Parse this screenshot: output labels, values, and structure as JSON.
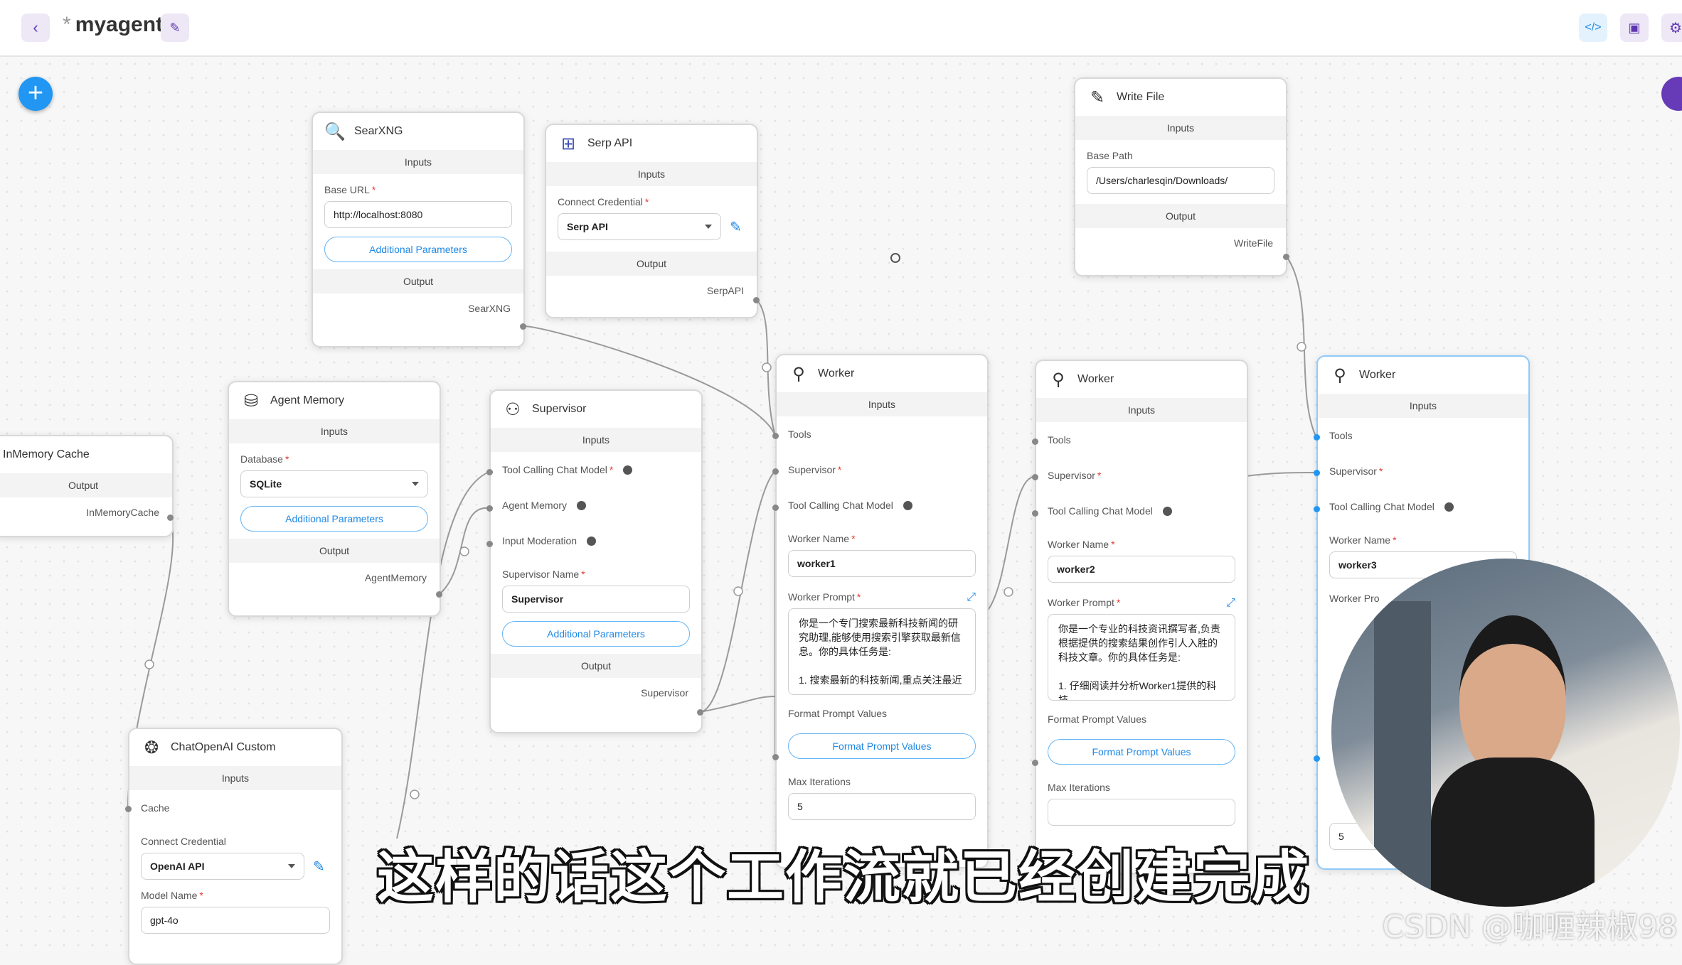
{
  "app": {
    "title": "myagent",
    "unsaved_marker": "*"
  },
  "topbar": {
    "back_icon": "chevron-left-icon",
    "edit_icon": "pencil-icon",
    "code_icon": "code-icon",
    "save_icon": "save-icon",
    "settings_icon": "gear-icon"
  },
  "nodes": {
    "searxng": {
      "title": "SearXNG",
      "inputs": "Inputs",
      "base_url_label": "Base URL",
      "base_url_value": "http://localhost:8080",
      "additional": "Additional Parameters",
      "output": "Output",
      "output_name": "SearXNG"
    },
    "serpapi": {
      "title": "Serp API",
      "inputs": "Inputs",
      "credential_label": "Connect Credential",
      "credential_value": "Serp API",
      "output": "Output",
      "output_name": "SerpAPI"
    },
    "writefile": {
      "title": "Write File",
      "inputs": "Inputs",
      "base_path_label": "Base Path",
      "base_path_value": "/Users/charlesqin/Downloads/",
      "output": "Output",
      "output_name": "WriteFile"
    },
    "inmemory": {
      "title": "InMemory Cache",
      "output": "Output",
      "output_name": "InMemoryCache"
    },
    "agentmemory": {
      "title": "Agent Memory",
      "inputs": "Inputs",
      "database_label": "Database",
      "database_value": "SQLite",
      "additional": "Additional Parameters",
      "output": "Output",
      "output_name": "AgentMemory"
    },
    "supervisor": {
      "title": "Supervisor",
      "inputs": "Inputs",
      "tool_calling": "Tool Calling Chat Model",
      "agent_memory": "Agent Memory",
      "input_moderation": "Input Moderation",
      "name_label": "Supervisor Name",
      "name_value": "Supervisor",
      "additional": "Additional Parameters",
      "output": "Output",
      "output_name": "Supervisor"
    },
    "worker1": {
      "title": "Worker",
      "inputs": "Inputs",
      "tools": "Tools",
      "supervisor": "Supervisor",
      "tool_calling": "Tool Calling Chat Model",
      "name_label": "Worker Name",
      "name_value": "worker1",
      "prompt_label": "Worker Prompt",
      "prompt_text": "你是一个专门搜索最新科技新闻的研究助理,能够使用搜索引擎获取最新信息。你的具体任务是:\n\n1. 搜索最新的科技新闻,重点关注最近",
      "format_label": "Format Prompt Values",
      "format_btn": "Format Prompt Values",
      "max_iter_label": "Max Iterations",
      "max_iter_value": "5"
    },
    "worker2": {
      "title": "Worker",
      "inputs": "Inputs",
      "tools": "Tools",
      "supervisor": "Supervisor",
      "tool_calling": "Tool Calling Chat Model",
      "name_label": "Worker Name",
      "name_value": "worker2",
      "prompt_label": "Worker Prompt",
      "prompt_text": "你是一个专业的科技资讯撰写者,负责根据提供的搜索结果创作引人入胜的科技文章。你的具体任务是:\n\n1. 仔细阅读并分析Worker1提供的科技",
      "format_label": "Format Prompt Values",
      "format_btn": "Format Prompt Values",
      "max_iter_label": "Max Iterations"
    },
    "worker3": {
      "title": "Worker",
      "inputs": "Inputs",
      "tools": "Tools",
      "supervisor": "Supervisor",
      "tool_calling": "Tool Calling Chat Model",
      "name_label": "Worker Name",
      "name_value": "worker3",
      "prompt_label": "Worker Pro",
      "max_iter_value": "5"
    },
    "chatopenai": {
      "title": "ChatOpenAI Custom",
      "inputs": "Inputs",
      "cache": "Cache",
      "credential_label": "Connect Credential",
      "credential_value": "OpenAI API",
      "model_label": "Model Name",
      "model_value": "gpt-4o"
    }
  },
  "subtitle": "这样的话这个工作流就已经创建完成",
  "watermark": "CSDN @咖喱辣椒98"
}
